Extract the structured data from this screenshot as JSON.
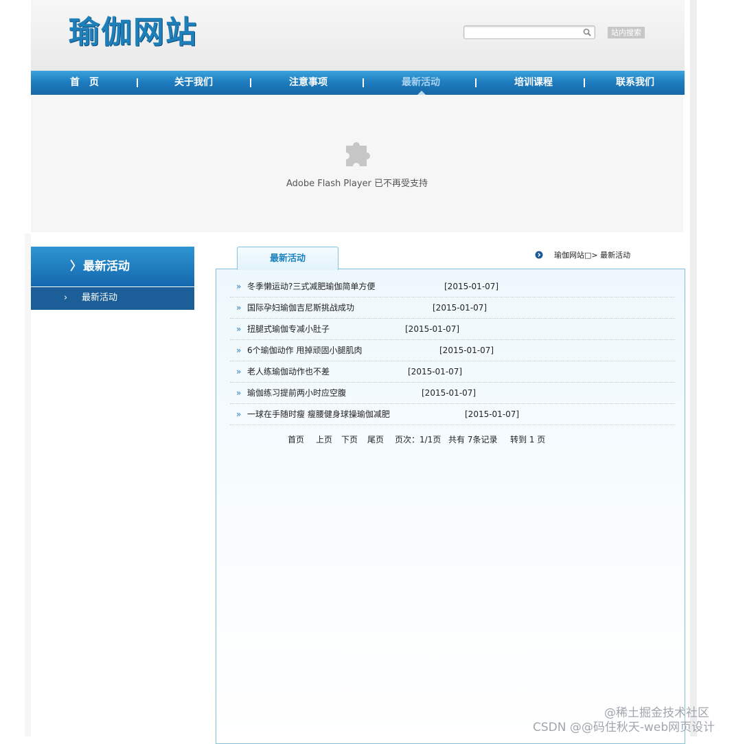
{
  "header": {
    "logo_text": "瑜伽网站",
    "search": {
      "value": "",
      "placeholder": ""
    },
    "search_button": "站内搜索"
  },
  "nav": {
    "items": [
      {
        "label": "首　页"
      },
      {
        "label": "关于我们"
      },
      {
        "label": "注意事项"
      },
      {
        "label": "最新活动",
        "active": true
      },
      {
        "label": "培训课程"
      },
      {
        "label": "联系我们"
      }
    ],
    "separator": "|"
  },
  "flash": {
    "message": "Adobe Flash Player 已不再受支持"
  },
  "sidebar": {
    "title_chevron": "〉",
    "title": "最新活动",
    "item_chevron": "›",
    "items": [
      {
        "label": "最新活动"
      }
    ]
  },
  "main": {
    "tab": "最新活动",
    "breadcrumb": "瑜伽网站□> 最新活动",
    "bullet": "»",
    "articles": [
      {
        "title": "冬季懒运动?三式减肥瑜伽简单方便",
        "date": "[2015-01-07]"
      },
      {
        "title": "国际孕妇瑜伽吉尼斯挑战成功",
        "date": "[2015-01-07]"
      },
      {
        "title": "扭腿式瑜伽专减小肚子",
        "date": "[2015-01-07]"
      },
      {
        "title": "6个瑜伽动作 甩掉顽固小腿肌肉",
        "date": "[2015-01-07]"
      },
      {
        "title": "老人练瑜伽动作也不差",
        "date": "[2015-01-07]"
      },
      {
        "title": "瑜伽练习提前两小时应空腹",
        "date": "[2015-01-07]"
      },
      {
        "title": "一球在手随时瘦 瘦腰健身球操瑜伽减肥",
        "date": "[2015-01-07]"
      }
    ],
    "pager": {
      "first": "首页",
      "prev": "上页",
      "next": "下页",
      "last": "尾页",
      "page_info": "页次：1/1页",
      "total": "共有 7条记录",
      "goto": "转到 1 页"
    }
  },
  "watermark": {
    "line1": "@稀土掘金技术社区",
    "line2": "CSDN @@码住秋天-web网页设计"
  },
  "colors": {
    "nav_blue": "#1f7ec0",
    "link_blue": "#1b82bd",
    "sidebar_dark": "#1c5f98"
  }
}
